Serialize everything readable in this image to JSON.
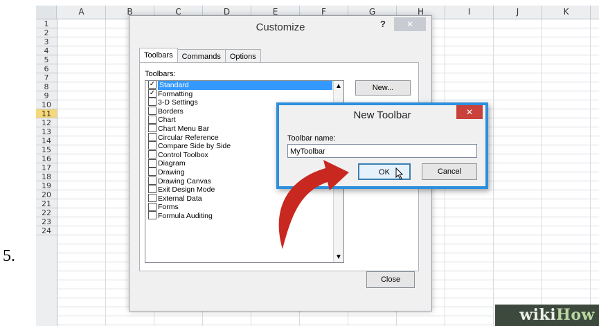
{
  "step_number": "5.",
  "spreadsheet": {
    "columns": [
      "A",
      "B",
      "C",
      "D",
      "E",
      "F",
      "G",
      "H",
      "I",
      "J",
      "K"
    ],
    "rows": [
      "1",
      "2",
      "3",
      "4",
      "5",
      "6",
      "7",
      "8",
      "9",
      "10",
      "11",
      "12",
      "13",
      "14",
      "15",
      "16",
      "17",
      "18",
      "19",
      "20",
      "21",
      "22",
      "23",
      "24"
    ],
    "selected_row": "11"
  },
  "customize_dialog": {
    "title": "Customize",
    "help_label": "?",
    "close_glyph": "✕",
    "tabs": [
      {
        "label": "Toolbars",
        "active": true
      },
      {
        "label": "Commands",
        "active": false
      },
      {
        "label": "Options",
        "active": false
      }
    ],
    "toolbars_label": "Toolbars:",
    "toolbars": [
      {
        "label": "Standard",
        "checked": true,
        "selected": true
      },
      {
        "label": "Formatting",
        "checked": true,
        "selected": false
      },
      {
        "label": "3-D Settings",
        "checked": false,
        "selected": false
      },
      {
        "label": "Borders",
        "checked": false,
        "selected": false
      },
      {
        "label": "Chart",
        "checked": false,
        "selected": false
      },
      {
        "label": "Chart Menu Bar",
        "checked": false,
        "selected": false
      },
      {
        "label": "Circular Reference",
        "checked": false,
        "selected": false
      },
      {
        "label": "Compare Side by Side",
        "checked": false,
        "selected": false
      },
      {
        "label": "Control Toolbox",
        "checked": false,
        "selected": false
      },
      {
        "label": "Diagram",
        "checked": false,
        "selected": false
      },
      {
        "label": "Drawing",
        "checked": false,
        "selected": false
      },
      {
        "label": "Drawing Canvas",
        "checked": false,
        "selected": false
      },
      {
        "label": "Exit Design Mode",
        "checked": false,
        "selected": false
      },
      {
        "label": "External Data",
        "checked": false,
        "selected": false
      },
      {
        "label": "Forms",
        "checked": false,
        "selected": false
      },
      {
        "label": "Formula Auditing",
        "checked": false,
        "selected": false
      }
    ],
    "new_button": "New...",
    "close_button": "Close"
  },
  "new_toolbar_dialog": {
    "title": "New Toolbar",
    "close_glyph": "✕",
    "name_label": "Toolbar name:",
    "name_value": "MyToolbar",
    "ok_button": "OK",
    "cancel_button": "Cancel"
  },
  "watermark": {
    "part1": "wiki",
    "part2": "How"
  },
  "colors": {
    "accent_blue": "#2d8fdd",
    "close_red": "#c9413a",
    "arrow_red": "#c8281f",
    "selection_blue": "#3399ff"
  }
}
